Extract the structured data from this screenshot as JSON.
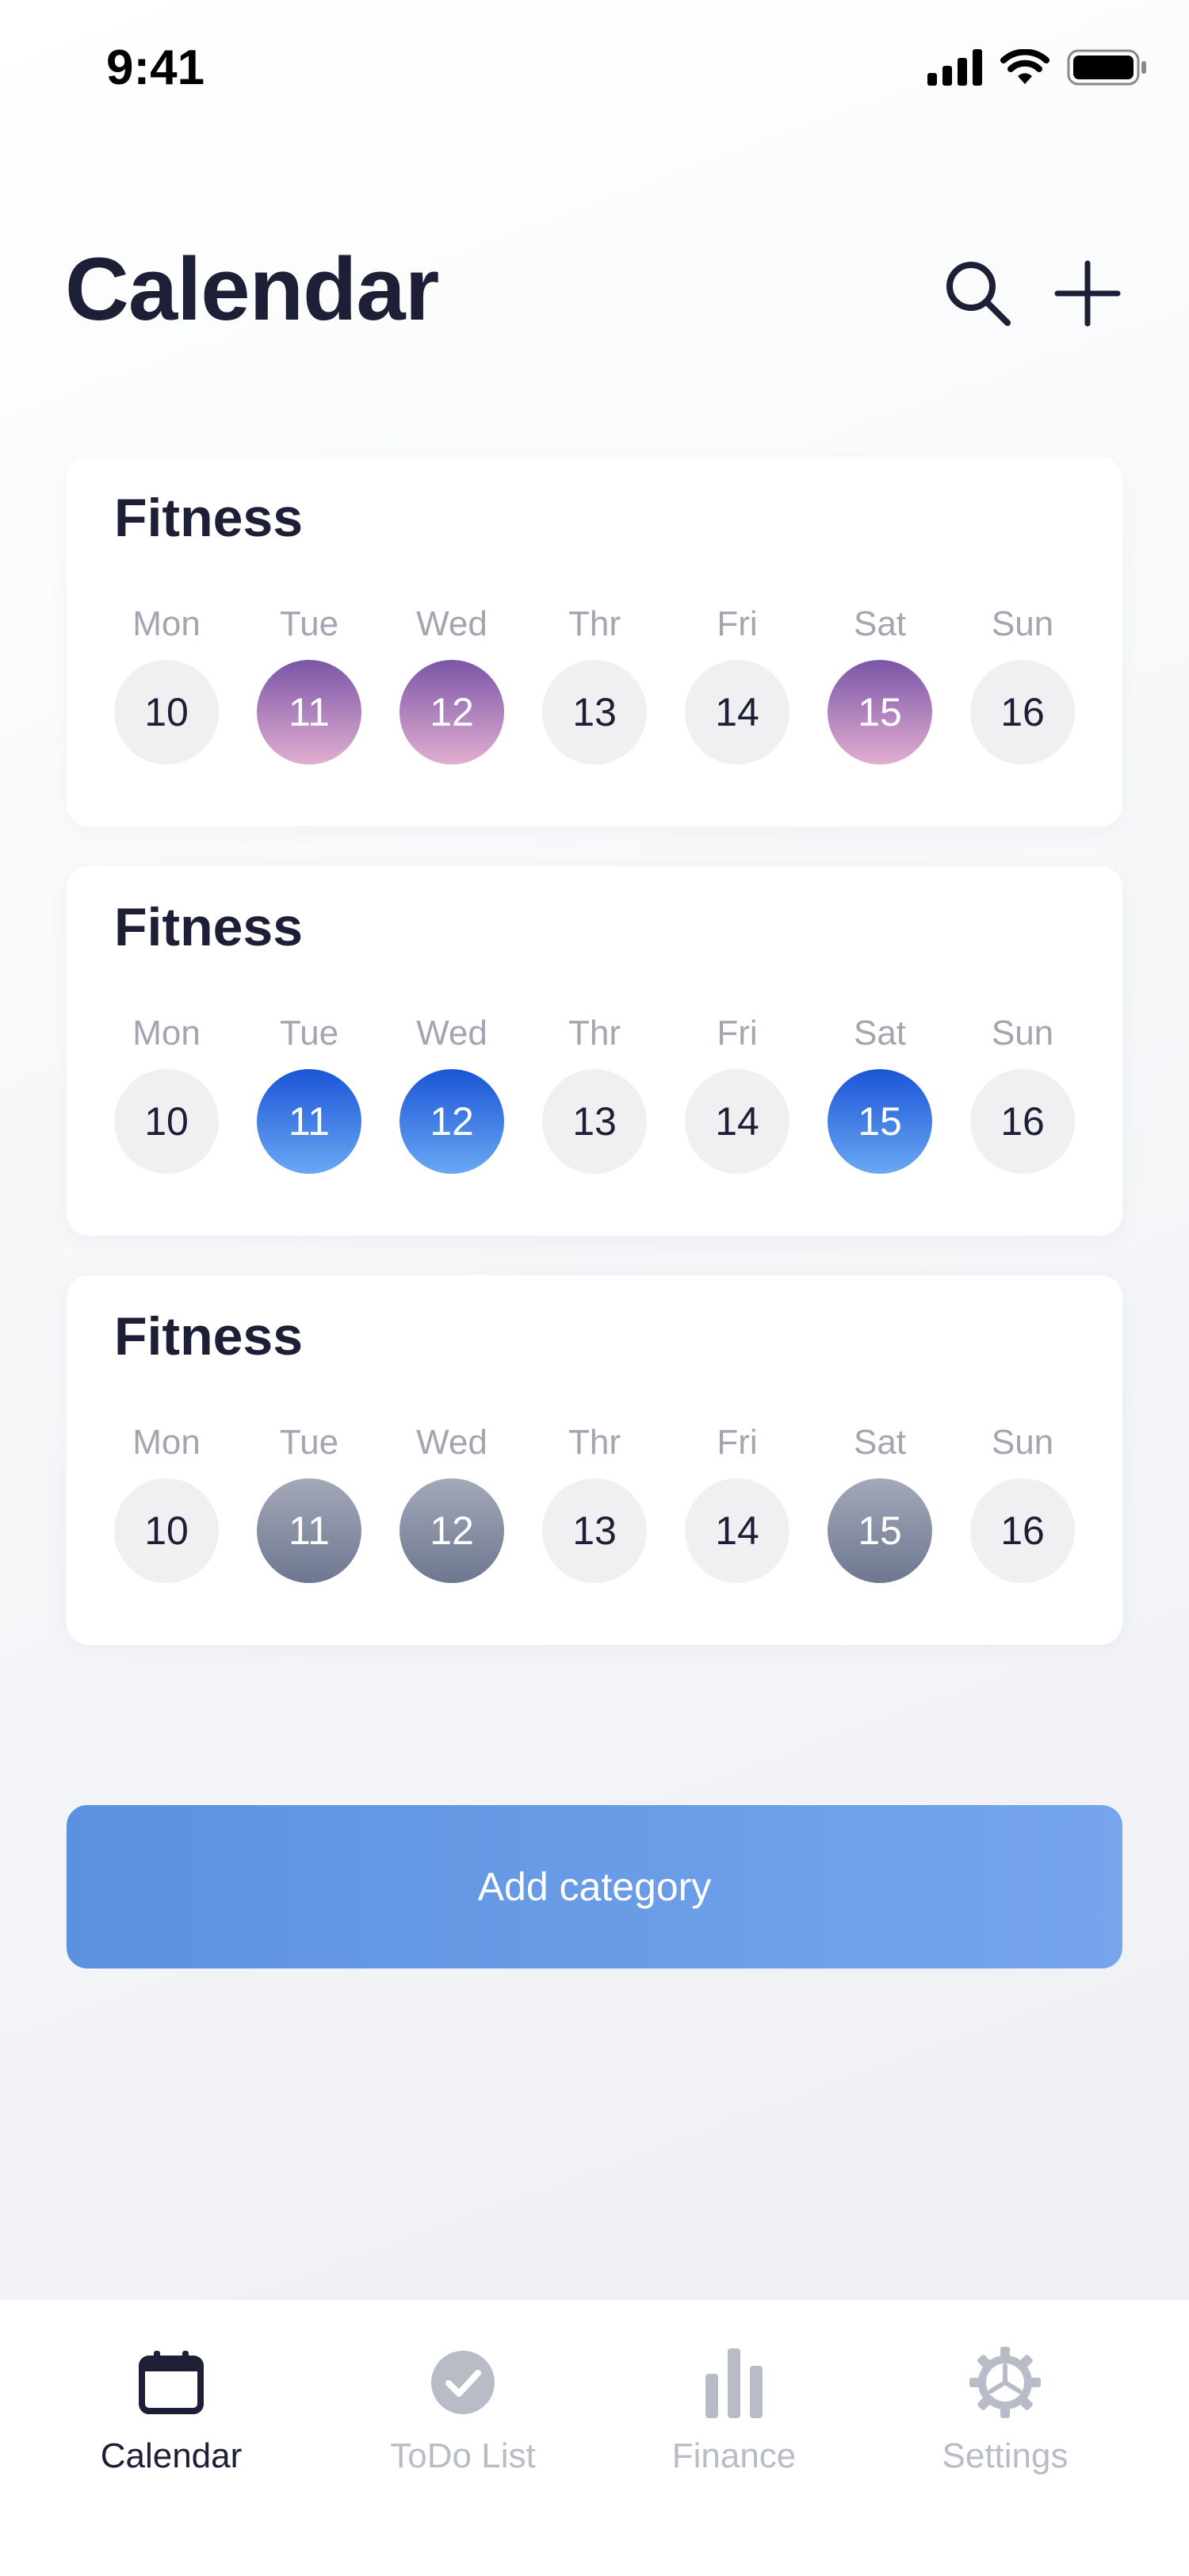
{
  "status_bar": {
    "time": "9:41"
  },
  "header": {
    "title": "Calendar"
  },
  "day_names": [
    "Mon",
    "Tue",
    "Wed",
    "Thr",
    "Fri",
    "Sat",
    "Sun"
  ],
  "cards": [
    {
      "title": "Fitness",
      "theme": "purple",
      "days": [
        {
          "num": "10",
          "on": false
        },
        {
          "num": "11",
          "on": true
        },
        {
          "num": "12",
          "on": true
        },
        {
          "num": "13",
          "on": false
        },
        {
          "num": "14",
          "on": false
        },
        {
          "num": "15",
          "on": true
        },
        {
          "num": "16",
          "on": false
        }
      ]
    },
    {
      "title": "Fitness",
      "theme": "blue",
      "days": [
        {
          "num": "10",
          "on": false
        },
        {
          "num": "11",
          "on": true
        },
        {
          "num": "12",
          "on": true
        },
        {
          "num": "13",
          "on": false
        },
        {
          "num": "14",
          "on": false
        },
        {
          "num": "15",
          "on": true
        },
        {
          "num": "16",
          "on": false
        }
      ]
    },
    {
      "title": "Fitness",
      "theme": "gray",
      "days": [
        {
          "num": "10",
          "on": false
        },
        {
          "num": "11",
          "on": true
        },
        {
          "num": "12",
          "on": true
        },
        {
          "num": "13",
          "on": false
        },
        {
          "num": "14",
          "on": false
        },
        {
          "num": "15",
          "on": true
        },
        {
          "num": "16",
          "on": false
        }
      ]
    }
  ],
  "add_category_label": "Add category",
  "tabs": [
    {
      "label": "Calendar",
      "icon": "calendar-icon",
      "active": true
    },
    {
      "label": "ToDo List",
      "icon": "check-circle-icon",
      "active": false
    },
    {
      "label": "Finance",
      "icon": "bar-chart-icon",
      "active": false
    },
    {
      "label": "Settings",
      "icon": "gear-icon",
      "active": false
    }
  ],
  "colors": {
    "primary_text": "#1d1f36",
    "muted_text": "#a3a6b1",
    "accent_button": "#5c91e0",
    "inactive_tab": "#b8bcc6"
  }
}
